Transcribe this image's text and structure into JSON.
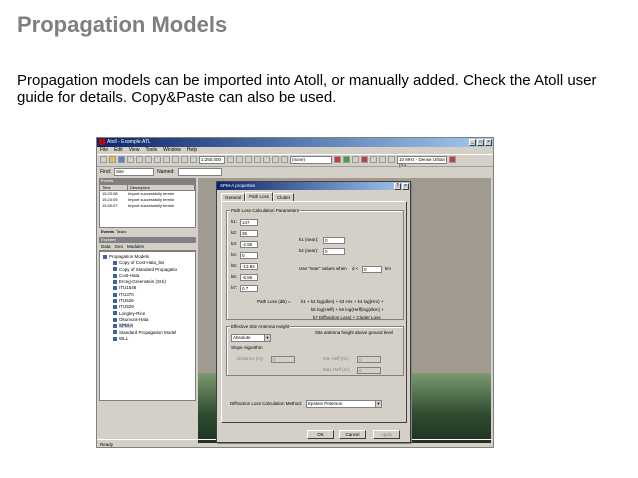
{
  "slide": {
    "title": "Propagation Models",
    "body": "Propagation models can be imported into Atoll, or manually added. Check the Atoll user guide for details. Copy&Paste can also be used."
  },
  "app": {
    "title": "Atoll - Example.ATL",
    "menus": [
      "File",
      "Edit",
      "View",
      "Tools",
      "Window",
      "Help"
    ],
    "scale_value": "1:250,000",
    "zoom_combo": "(none)",
    "carrier_combo": "10 MHz - Dense Urban (3 •",
    "find_label": "Find:",
    "find_value": "Site",
    "named_label": "Named:",
    "events_panel_title": "Events",
    "events_columns": [
      "Time",
      "Description"
    ],
    "events": [
      {
        "time": "15:23:08",
        "desc": "Import successfully termin"
      },
      {
        "time": "15:24:05",
        "desc": "Import successfully termin"
      },
      {
        "time": "15:49:07",
        "desc": "Import successfully termin"
      }
    ],
    "events_tabs": [
      "Events",
      "Tasks"
    ],
    "explorer_title": "Explorer",
    "explorer_tabs": [
      "Data",
      "Geo",
      "Modules"
    ],
    "tree_root": "Propagation Models",
    "tree_items": [
      "Copy of Cost-Hata_bis",
      "Copy of Standard Propagatio",
      "Cost-Hata",
      "Erceg-Greenstein (SUI)",
      "ITU1546",
      "ITU370",
      "ITU526",
      "ITU529",
      "Longley-Rice",
      "Okumura-Hata",
      "SPM-A",
      "Standard Propagation Model",
      "WLL"
    ],
    "status": "Ready"
  },
  "dialog": {
    "title": "SPM-A properties",
    "tabs": [
      "General",
      "Path Loss",
      "Clutter"
    ],
    "active_tab": "Path Loss",
    "group_path_loss": "Path Loss Calculation Parameters",
    "k_params": [
      {
        "label": "k1:",
        "value": "147"
      },
      {
        "label": "k2:",
        "value": "36"
      },
      {
        "label": "k3:",
        "value": "-2.55"
      },
      {
        "label": "k4:",
        "value": "0"
      },
      {
        "label": "k5:",
        "value": "-13.82"
      },
      {
        "label": "k6:",
        "value": "-6.55"
      },
      {
        "label": "k7:",
        "value": "0.7"
      }
    ],
    "k1_near_label": "k1 (near):",
    "k1_near_value": "0",
    "k2_near_label": "k2 (near):",
    "k2_near_value": "0",
    "use_near_label": "Use \"near\" values when",
    "d_label": "d <",
    "d_value": "0",
    "d_unit": "km",
    "formula_prefix": "Path Loss (dB) =",
    "formula_lines": [
      "k1 + k2 log(dkm) + k3 Hrx + k4 log(Hrx) +",
      "k5 log(Heff) + k6 log(Heff)log(dkm) +",
      "k7 Diffraction Loss) + Clutter Loss"
    ],
    "group_antenna": "Effective Site Antenna Height",
    "antenna_method": "Absolute",
    "antenna_note": "Site antenna height above ground level",
    "group_slope": "Slope Algorithm",
    "distance_label": "Distance (m):",
    "distance_value": "0",
    "min_heff_label": "Min Heff (m):",
    "min_heff_value": "0",
    "max_heff_label": "Max Heff (m):",
    "max_heff_value": "0",
    "diffraction_label": "Diffraction Loss Calculation Method:",
    "diffraction_value": "Epstein Peterson",
    "buttons": {
      "ok": "OK",
      "cancel": "Cancel",
      "apply": "Apply"
    }
  }
}
